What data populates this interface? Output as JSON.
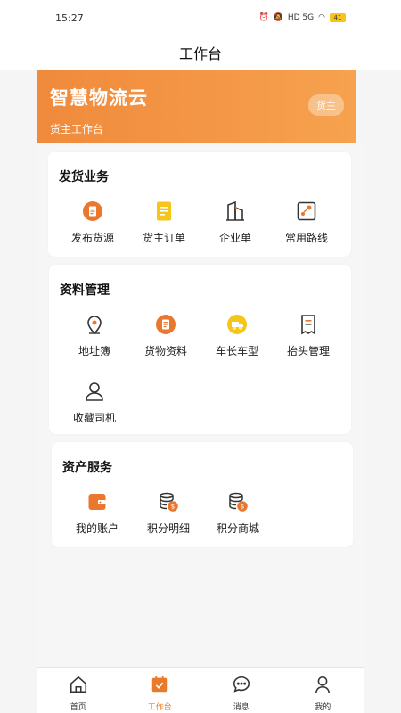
{
  "status_bar": {
    "time": "15:27",
    "network": "HD 5G",
    "battery": "41"
  },
  "nav": {
    "title": "工作台"
  },
  "hero": {
    "title": "智慧物流云",
    "subtitle": "货主工作台",
    "role": "货主"
  },
  "sections": [
    {
      "title": "发货业务",
      "items": [
        {
          "label": "发布货源",
          "icon": "publish-cargo-icon"
        },
        {
          "label": "货主订单",
          "icon": "order-document-icon"
        },
        {
          "label": "企业单",
          "icon": "enterprise-building-icon"
        },
        {
          "label": "常用路线",
          "icon": "route-map-icon"
        }
      ]
    },
    {
      "title": "资料管理",
      "items": [
        {
          "label": "地址簿",
          "icon": "location-pin-icon"
        },
        {
          "label": "货物资料",
          "icon": "cargo-info-icon"
        },
        {
          "label": "车长车型",
          "icon": "truck-icon"
        },
        {
          "label": "抬头管理",
          "icon": "receipt-icon"
        },
        {
          "label": "收藏司机",
          "icon": "person-icon"
        }
      ]
    },
    {
      "title": "资产服务",
      "items": [
        {
          "label": "我的账户",
          "icon": "wallet-icon"
        },
        {
          "label": "积分明细",
          "icon": "coins-icon"
        },
        {
          "label": "积分商城",
          "icon": "coins-shop-icon"
        }
      ]
    }
  ],
  "tabbar": [
    {
      "label": "首页",
      "icon": "home-icon",
      "active": false
    },
    {
      "label": "工作台",
      "icon": "calendar-check-icon",
      "active": true
    },
    {
      "label": "消息",
      "icon": "chat-bubble-icon",
      "active": false
    },
    {
      "label": "我的",
      "icon": "user-icon",
      "active": false
    }
  ],
  "colors": {
    "accent": "#f08a3c",
    "accent_light": "#f6a24e",
    "yellow": "#f5c518"
  }
}
